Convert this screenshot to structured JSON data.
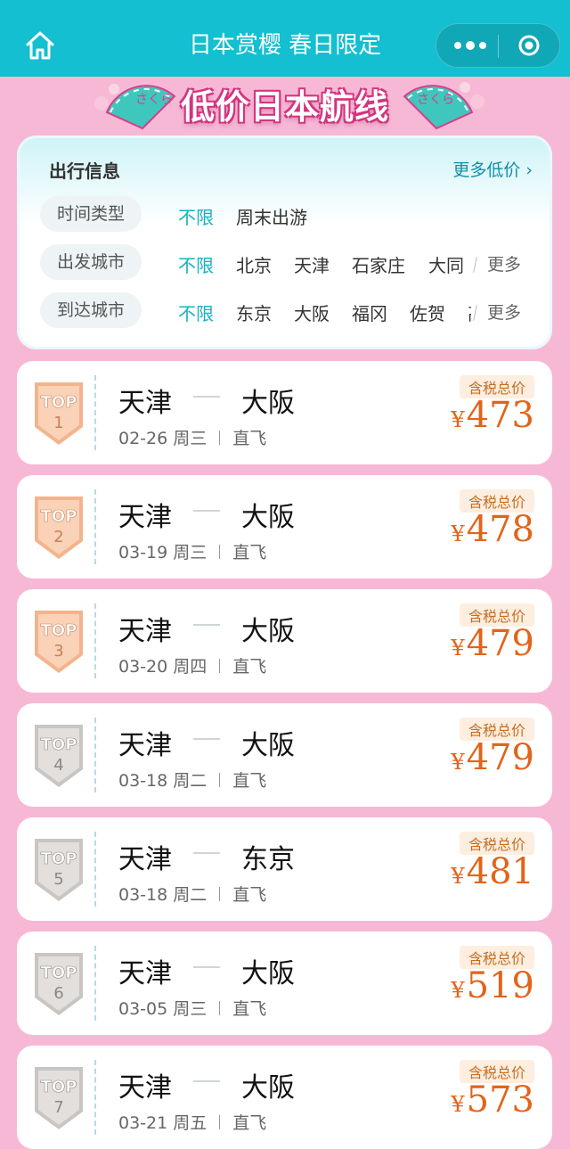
{
  "topbar": {
    "title": "日本赏樱 春日限定"
  },
  "banner": {
    "title": "低价日本航线",
    "fan_text": "さくら"
  },
  "info": {
    "title": "出行信息",
    "more_label": "更多低价",
    "rows": [
      {
        "label": "时间类型",
        "options": [
          "不限",
          "周末出游"
        ],
        "more": ""
      },
      {
        "label": "出发城市",
        "options": [
          "不限",
          "北京",
          "天津",
          "石家庄",
          "大同"
        ],
        "more": "更多"
      },
      {
        "label": "到达城市",
        "options": [
          "不限",
          "东京",
          "大阪",
          "福冈",
          "佐贺",
          "高"
        ],
        "more": "更多"
      }
    ]
  },
  "flights": [
    {
      "rank_label": "TOP",
      "rank": "1",
      "from": "天津",
      "to": "大阪",
      "date": "02-26",
      "weekday": "周三",
      "type": "直飞",
      "price_tag": "含税总价",
      "currency": "¥",
      "price": "473",
      "tier": "orange"
    },
    {
      "rank_label": "TOP",
      "rank": "2",
      "from": "天津",
      "to": "大阪",
      "date": "03-19",
      "weekday": "周三",
      "type": "直飞",
      "price_tag": "含税总价",
      "currency": "¥",
      "price": "478",
      "tier": "orange"
    },
    {
      "rank_label": "TOP",
      "rank": "3",
      "from": "天津",
      "to": "大阪",
      "date": "03-20",
      "weekday": "周四",
      "type": "直飞",
      "price_tag": "含税总价",
      "currency": "¥",
      "price": "479",
      "tier": "orange"
    },
    {
      "rank_label": "TOP",
      "rank": "4",
      "from": "天津",
      "to": "大阪",
      "date": "03-18",
      "weekday": "周二",
      "type": "直飞",
      "price_tag": "含税总价",
      "currency": "¥",
      "price": "479",
      "tier": "gray"
    },
    {
      "rank_label": "TOP",
      "rank": "5",
      "from": "天津",
      "to": "东京",
      "date": "03-18",
      "weekday": "周二",
      "type": "直飞",
      "price_tag": "含税总价",
      "currency": "¥",
      "price": "481",
      "tier": "gray"
    },
    {
      "rank_label": "TOP",
      "rank": "6",
      "from": "天津",
      "to": "大阪",
      "date": "03-05",
      "weekday": "周三",
      "type": "直飞",
      "price_tag": "含税总价",
      "currency": "¥",
      "price": "519",
      "tier": "gray"
    },
    {
      "rank_label": "TOP",
      "rank": "7",
      "from": "天津",
      "to": "大阪",
      "date": "03-21",
      "weekday": "周五",
      "type": "直飞",
      "price_tag": "含税总价",
      "currency": "¥",
      "price": "573",
      "tier": "gray"
    }
  ],
  "colors": {
    "topbar": "#13bfd0",
    "background": "#f7b8d6",
    "accent": "#12b3c2",
    "price": "#e2641a",
    "badge_orange": "#f3b48d",
    "badge_gray": "#c9c5c3"
  },
  "icons": [
    "home-icon",
    "more-dots-icon",
    "close-target-icon",
    "fan-icon",
    "rank-badge-icon"
  ]
}
